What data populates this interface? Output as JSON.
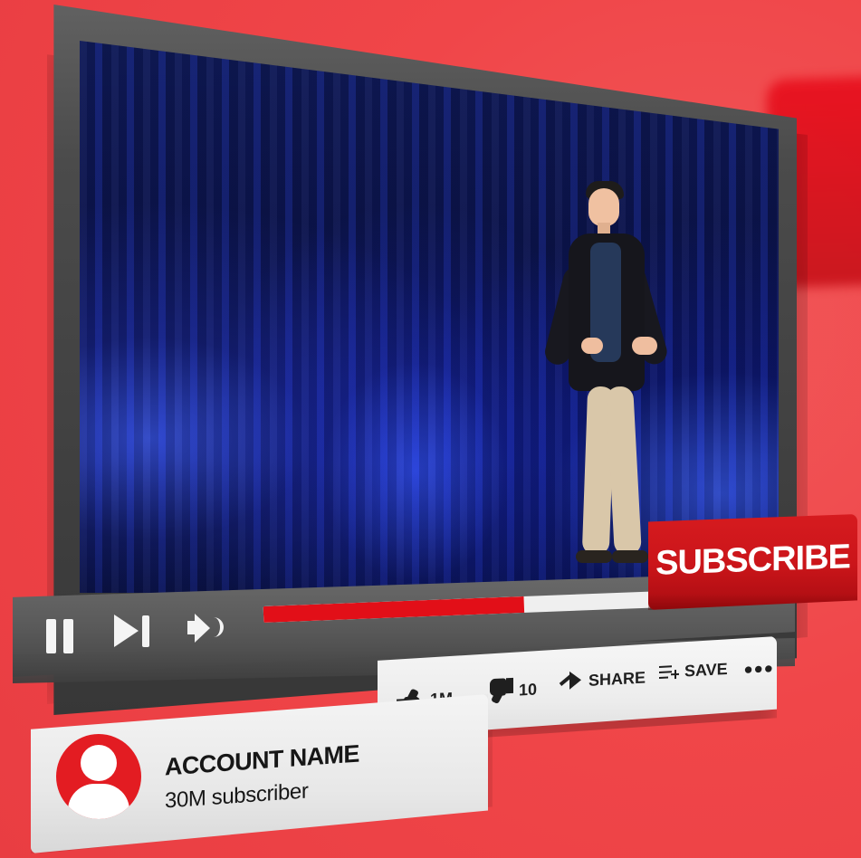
{
  "player": {
    "progress_percent": 66
  },
  "subscribe": {
    "label": "SUBSCRIBE"
  },
  "actions": {
    "like_count": "1M",
    "dislike_count": "10",
    "share_label": "SHARE",
    "save_label": "SAVE",
    "more_label": "•••"
  },
  "account": {
    "name": "ACCOUNT NAME",
    "subscribers": "30M subscriber"
  },
  "icons": {
    "pause": "pause-icon",
    "next": "next-icon",
    "volume": "volume-icon",
    "like": "thumbs-up-icon",
    "dislike": "thumbs-down-icon",
    "share": "share-icon",
    "save": "save-icon",
    "more": "more-icon",
    "avatar": "user-avatar-icon"
  },
  "colors": {
    "background": "#f24a4d",
    "accent_red": "#e20f18",
    "subscribe_red": "#cb151a",
    "frame_dark": "#4b4b4b",
    "card_light": "#f4f4f4",
    "text_dark": "#171717"
  }
}
